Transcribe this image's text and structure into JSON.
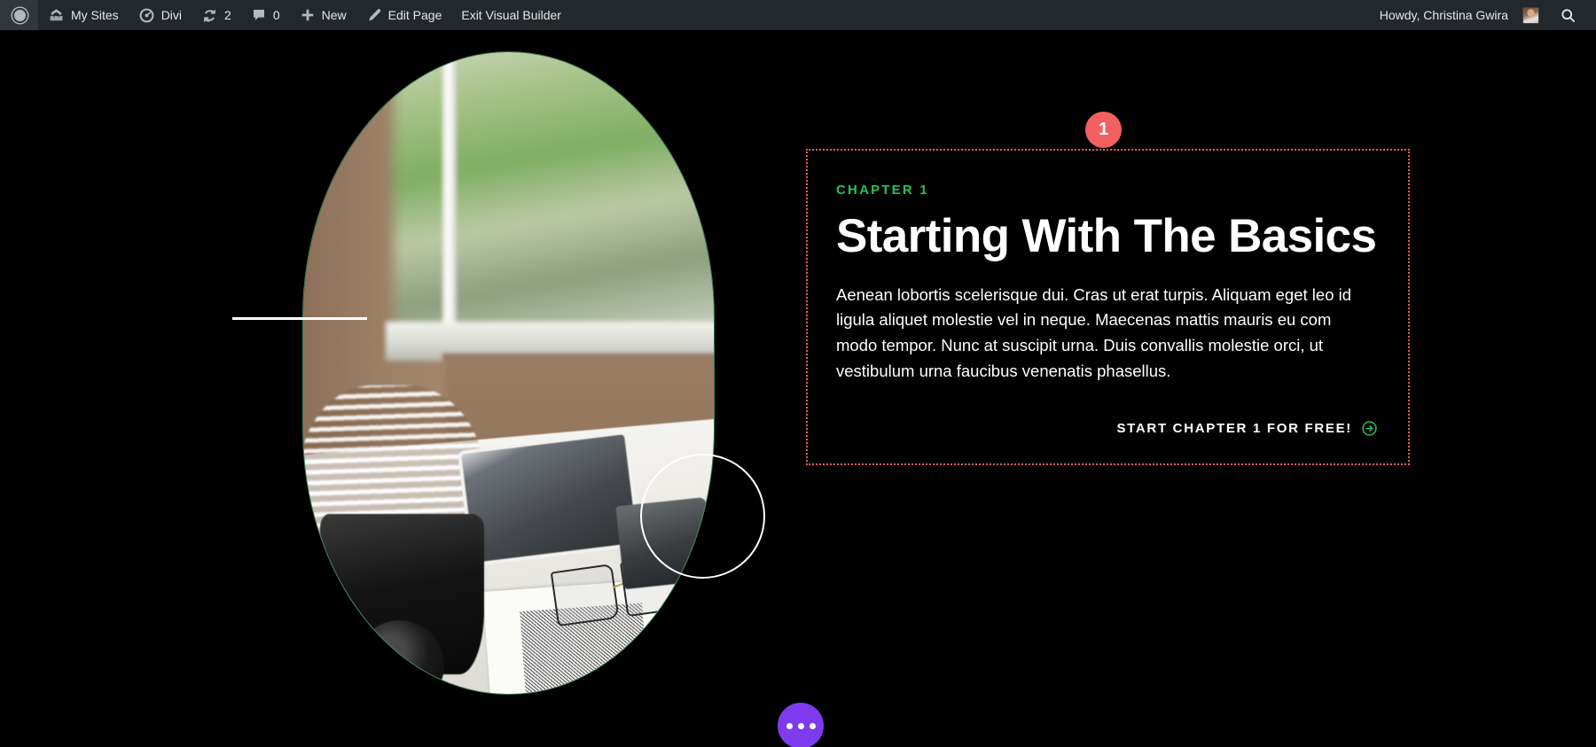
{
  "adminbar": {
    "left_items": [
      {
        "name": "wp-logo",
        "icon": "wordpress-icon",
        "label": ""
      },
      {
        "name": "my-sites",
        "icon": "sites-icon",
        "label": "My Sites"
      },
      {
        "name": "divi",
        "icon": "divi-icon",
        "label": "Divi"
      },
      {
        "name": "updates",
        "icon": "updates-icon",
        "label": "2"
      },
      {
        "name": "comments",
        "icon": "comment-bubble-icon",
        "label": "0"
      },
      {
        "name": "new-content",
        "icon": "plus-icon",
        "label": "New"
      },
      {
        "name": "edit-page",
        "icon": "pencil-icon",
        "label": "Edit Page"
      },
      {
        "name": "exit-visual-builder",
        "icon": "",
        "label": "Exit Visual Builder"
      }
    ],
    "greeting": "Howdy, Christina Gwira",
    "avatar_name": "user-avatar",
    "search_icon": "search-icon",
    "bar_bg": "#23282d",
    "text_color": "#e6e7e8"
  },
  "module": {
    "badge_number": "1",
    "badge_color": "#f2605f",
    "border_color": "#e35b5b",
    "eyebrow": "Chapter 1",
    "eyebrow_color": "#27c254",
    "headline": "Starting With The Basics",
    "body": "Aenean lobortis scelerisque dui. Cras ut erat turpis. Aliquam eget leo id ligula aliquet molestie vel in neque. Maecenas mattis mauris eu com modo tempor. Nunc at suscipit urna. Duis convallis molestie orci, ut vestibulum urna faucibus venenatis phasellus.",
    "cta_label": "Start Chapter 1 For Free!",
    "cta_icon": "circle-arrow-right-icon",
    "cta_icon_color": "#27c254"
  },
  "visual": {
    "image_alt": "desk-with-camera-tablet-and-glasses-by-window",
    "oval_outline_color": "#3f7d55",
    "deco_line_name": "decorative-white-line",
    "deco_circle_name": "decorative-white-circle"
  },
  "fab": {
    "name": "visual-builder-menu-button",
    "icon": "three-dots-icon",
    "color": "#7e3bed"
  },
  "page": {
    "background": "#000000"
  }
}
